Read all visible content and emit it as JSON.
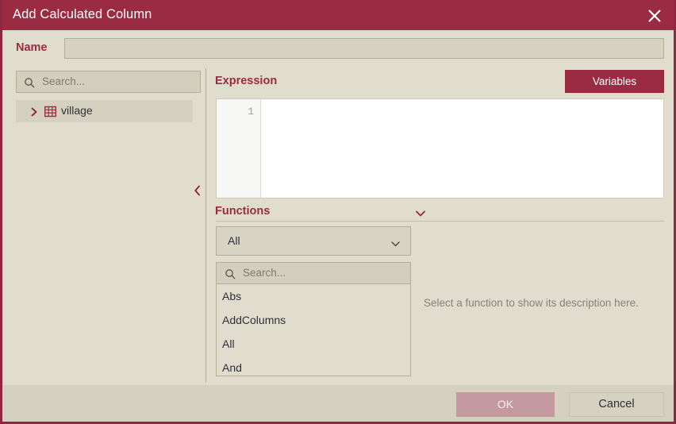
{
  "window": {
    "title": "Add Calculated Column",
    "close_icon": "close-icon",
    "accent": "#9a2b42",
    "background": "#e0ddcf",
    "footer_background": "#d4d1c0"
  },
  "name_row": {
    "label": "Name",
    "value": "",
    "placeholder": ""
  },
  "tree_panel": {
    "search": {
      "placeholder": "Search...",
      "value": "",
      "icon": "search-icon"
    },
    "items": [
      {
        "label": "village",
        "icon": "table-icon",
        "expander": "chevron-right-icon",
        "selected": true
      }
    ],
    "collapse_handle_icon": "chevron-left-icon"
  },
  "expression": {
    "label": "Expression",
    "variables_button": "Variables",
    "line_numbers": [
      "1"
    ],
    "code": ""
  },
  "functions": {
    "label": "Functions",
    "collapse_icon": "chevron-down-icon",
    "category_select": {
      "value": "All",
      "caret_icon": "chevron-down-icon"
    },
    "search": {
      "placeholder": "Search...",
      "value": "",
      "icon": "search-icon"
    },
    "list": [
      "Abs",
      "AddColumns",
      "All",
      "And"
    ],
    "description_placeholder": "Select a function to show its description here."
  },
  "footer": {
    "ok_label": "OK",
    "ok_disabled": true,
    "cancel_label": "Cancel"
  }
}
